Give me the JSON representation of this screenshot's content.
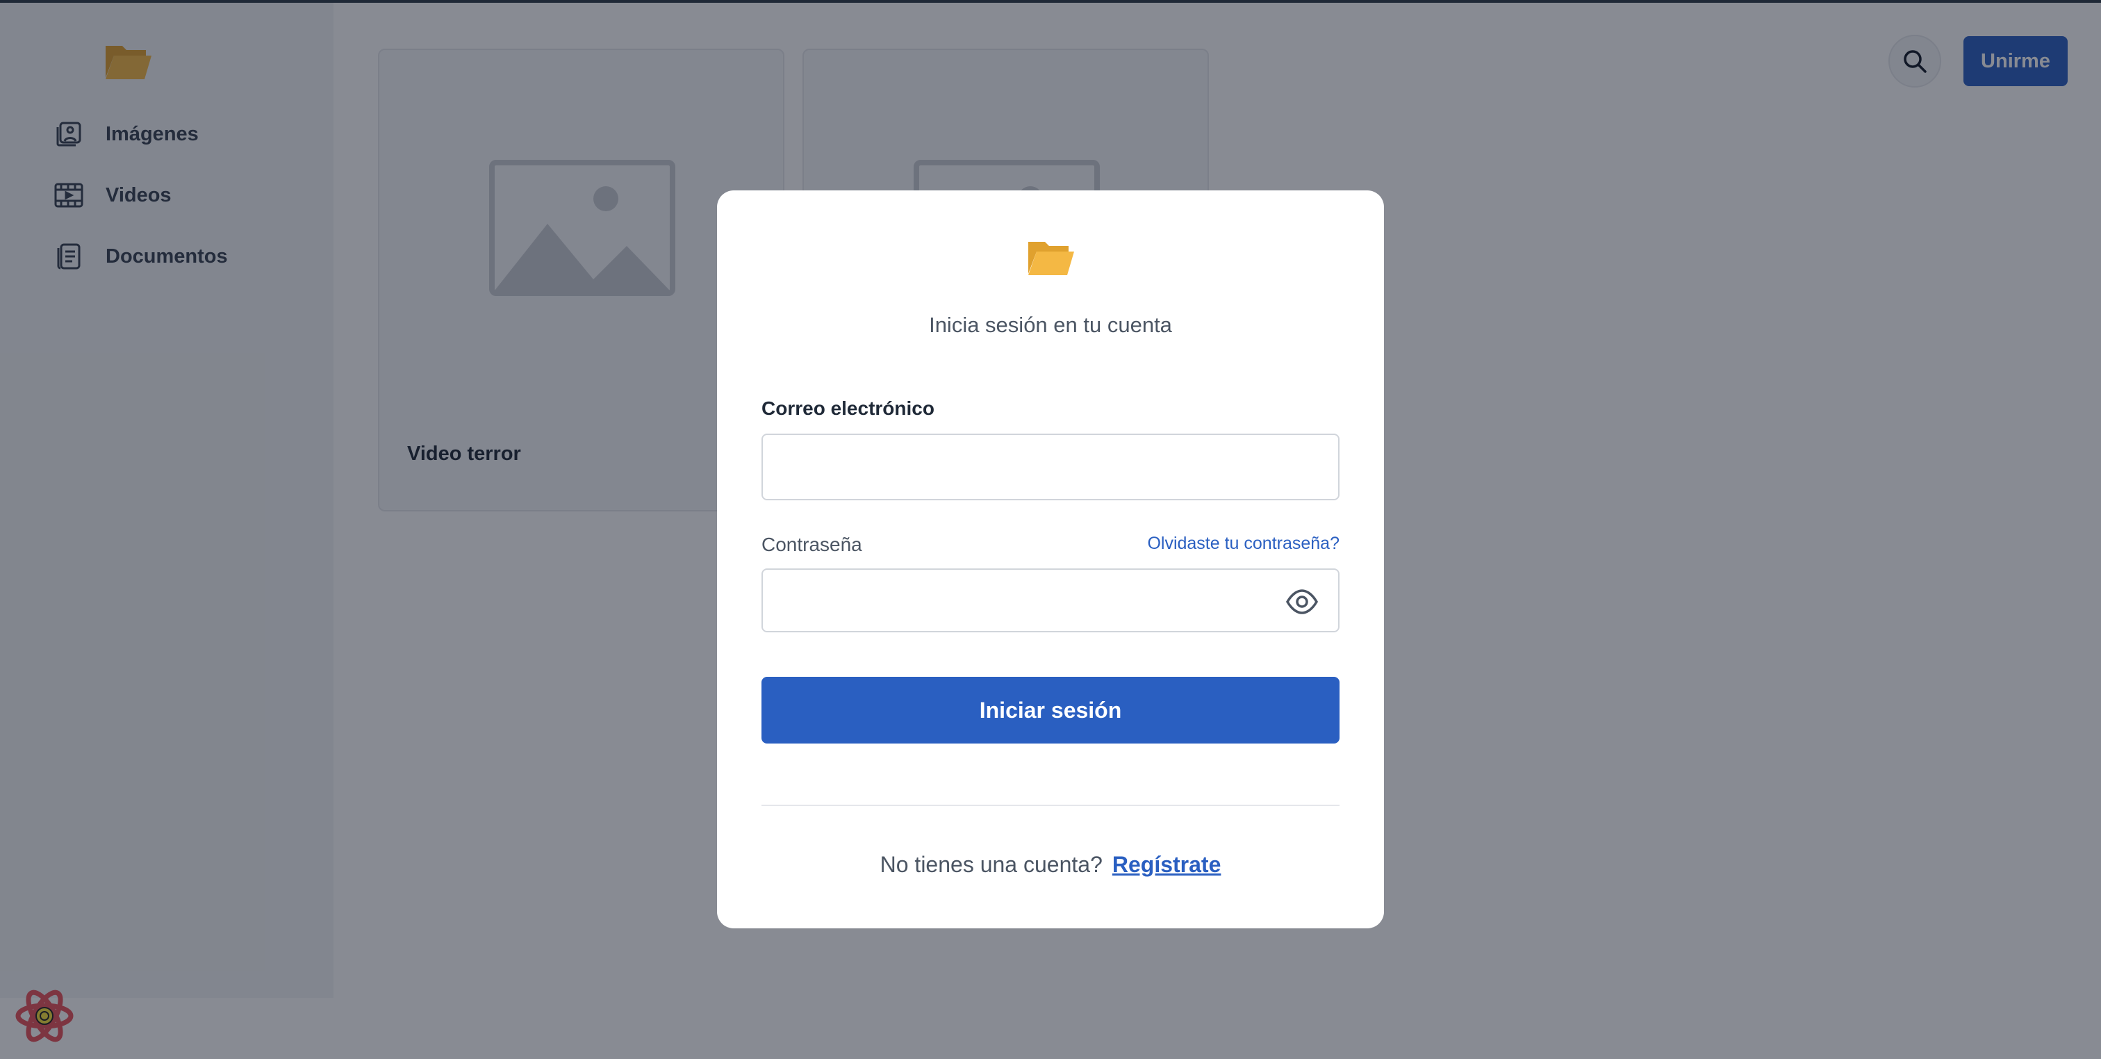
{
  "sidebar": {
    "logo_icon": "folder-open-icon",
    "items": [
      {
        "label": "Imágenes",
        "icon": "image-gallery-icon"
      },
      {
        "label": "Videos",
        "icon": "film-icon"
      },
      {
        "label": "Documentos",
        "icon": "document-icon"
      }
    ]
  },
  "header": {
    "search_icon": "search-icon",
    "join_label": "Unirme"
  },
  "main": {
    "cards": [
      {
        "title": "Video terror",
        "thumbnail_icon": "image-placeholder-icon"
      },
      {
        "title": "",
        "thumbnail_icon": "image-placeholder-icon"
      }
    ]
  },
  "modal": {
    "logo_icon": "folder-open-icon",
    "title": "Inicia sesión en tu cuenta",
    "email_label": "Correo electrónico",
    "email_value": "",
    "password_label": "Contraseña",
    "password_value": "",
    "forgot_label": "Olvidaste tu contraseña?",
    "submit_label": "Iniciar sesión",
    "no_account_text": "No tienes una cuenta?",
    "signup_label": "Regístrate"
  },
  "colors": {
    "primary": "#2a5fc1",
    "folder": "#f4b844",
    "overlay": "rgba(17,24,39,0.5)"
  }
}
